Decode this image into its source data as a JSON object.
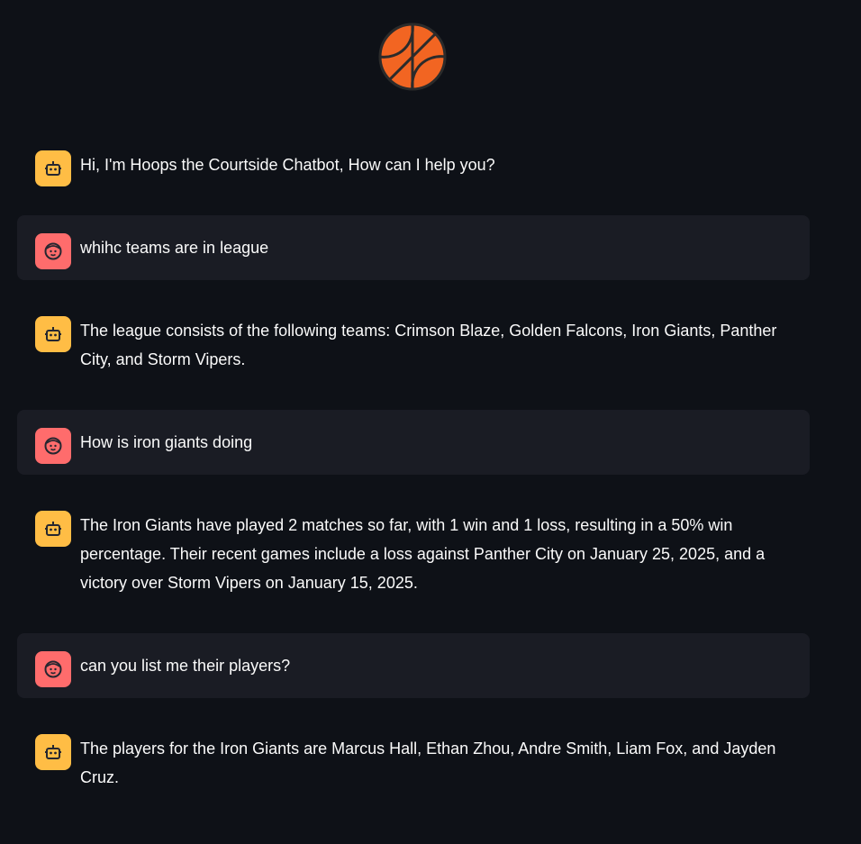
{
  "app": {
    "logo_icon": "basketball-icon",
    "colors": {
      "background": "#0e1117",
      "user_bubble": "#1a1c24",
      "bot_avatar": "#ffbd45",
      "user_avatar": "#ff6c6c",
      "basketball": "#f26522"
    }
  },
  "messages": [
    {
      "role": "assistant",
      "icon": "robot-icon",
      "text": "Hi, I'm Hoops the Courtside Chatbot, How can I help you?"
    },
    {
      "role": "user",
      "icon": "smiley-face-icon",
      "text": "whihc teams are in league"
    },
    {
      "role": "assistant",
      "icon": "robot-icon",
      "text": "The league consists of the following teams: Crimson Blaze, Golden Falcons, Iron Giants, Panther City, and Storm Vipers."
    },
    {
      "role": "user",
      "icon": "smiley-face-icon",
      "text": "How is iron giants doing"
    },
    {
      "role": "assistant",
      "icon": "robot-icon",
      "text": "The Iron Giants have played 2 matches so far, with 1 win and 1 loss, resulting in a 50% win percentage. Their recent games include a loss against Panther City on January 25, 2025, and a victory over Storm Vipers on January 15, 2025."
    },
    {
      "role": "user",
      "icon": "smiley-face-icon",
      "text": "can you list me their players?"
    },
    {
      "role": "assistant",
      "icon": "robot-icon",
      "text": "The players for the Iron Giants are Marcus Hall, Ethan Zhou, Andre Smith, Liam Fox, and Jayden Cruz."
    }
  ]
}
